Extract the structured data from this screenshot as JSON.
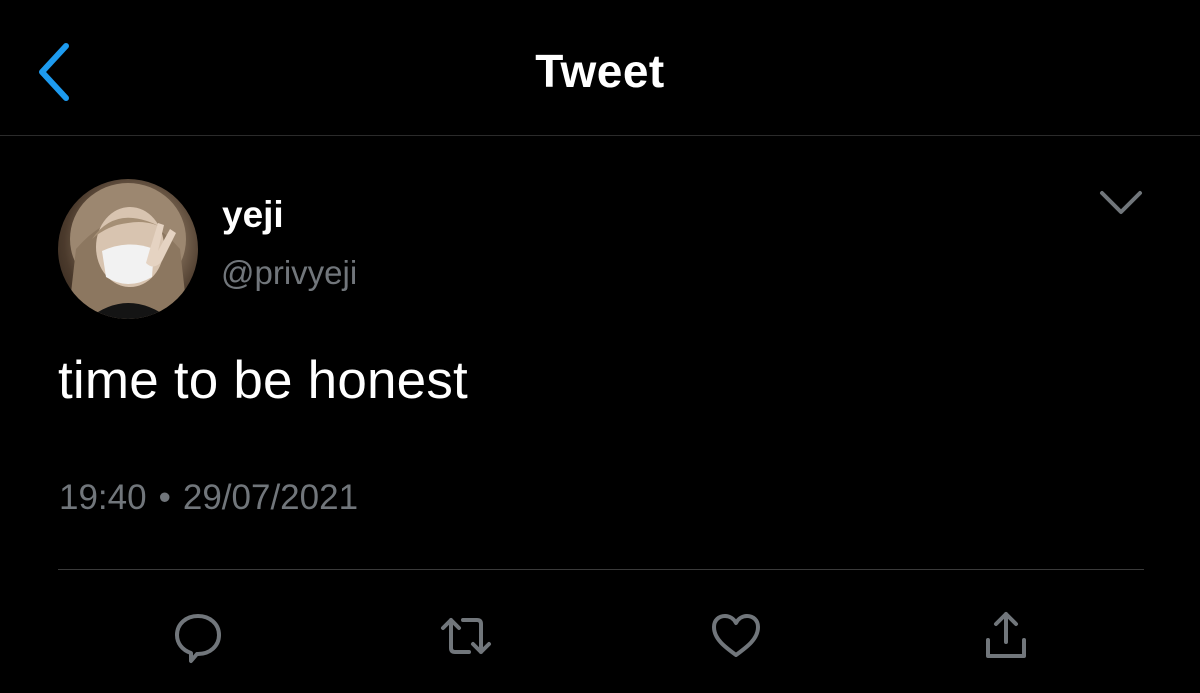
{
  "header": {
    "title": "Tweet",
    "back_icon": "chevron-left-icon"
  },
  "colors": {
    "background": "#000000",
    "accent": "#1d9bf0",
    "muted": "#71767b",
    "text": "#ffffff"
  },
  "tweet": {
    "author": {
      "display_name": "yeji",
      "handle": "@privyeji"
    },
    "text": "time to be honest",
    "time": "19:40",
    "separator": "•",
    "date": "29/07/2021",
    "more_icon": "chevron-down-icon"
  },
  "actions": [
    {
      "name": "reply",
      "icon": "reply-icon"
    },
    {
      "name": "retweet",
      "icon": "retweet-icon"
    },
    {
      "name": "like",
      "icon": "heart-icon"
    },
    {
      "name": "share",
      "icon": "share-icon"
    }
  ]
}
